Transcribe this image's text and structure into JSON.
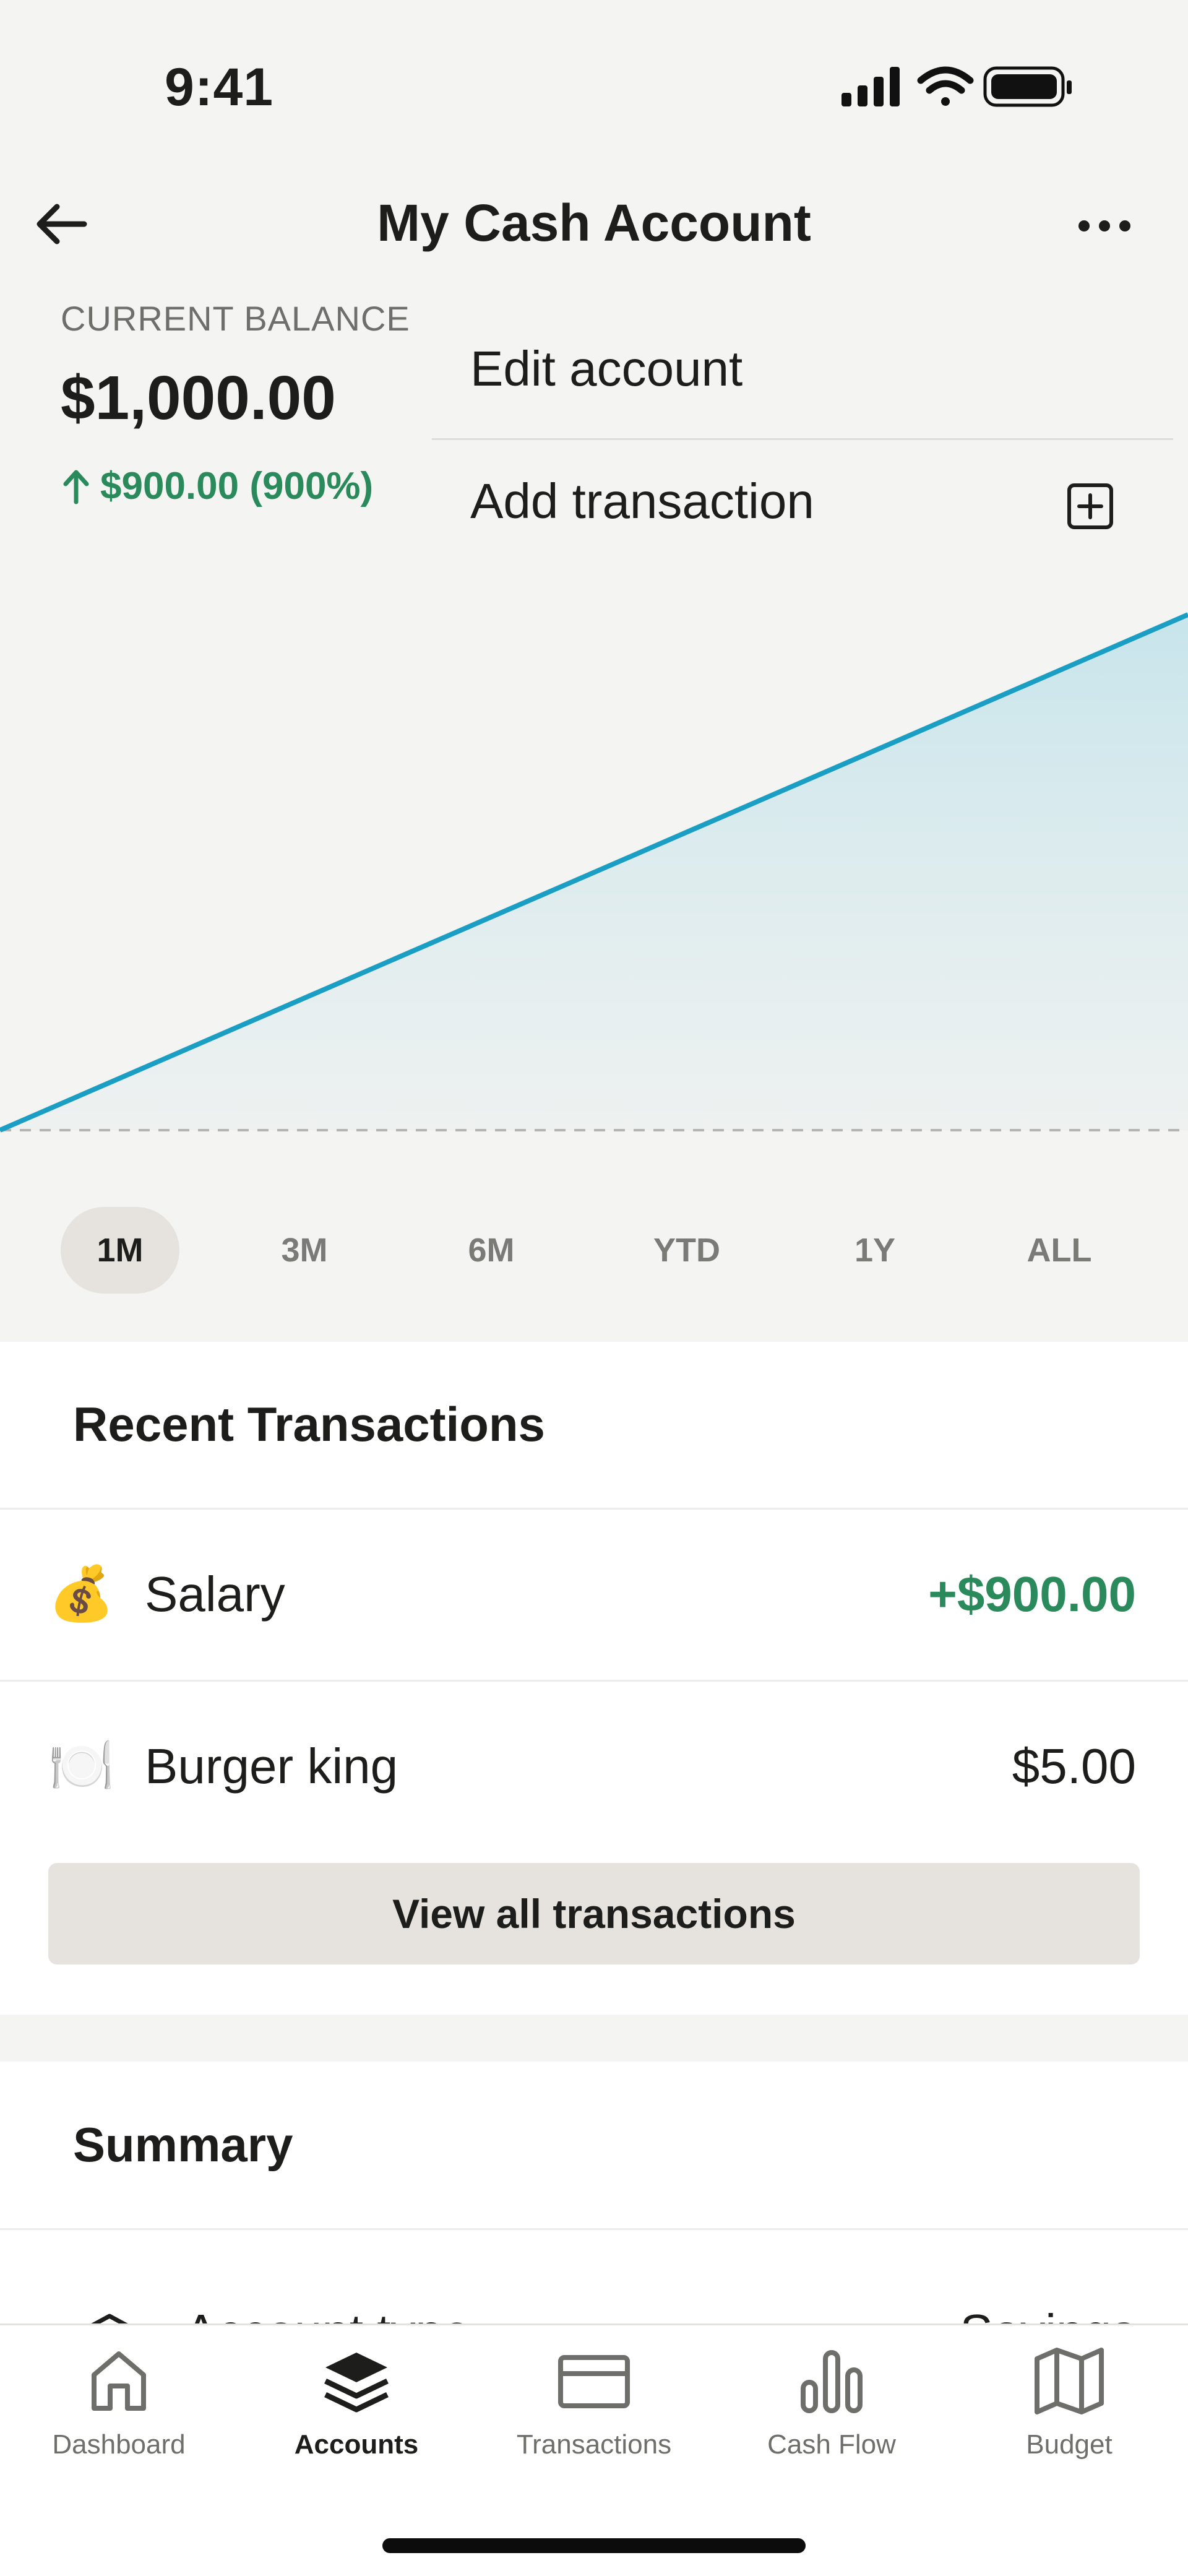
{
  "status_bar": {
    "time": "9:41"
  },
  "header": {
    "title": "My Cash Account"
  },
  "balance": {
    "label": "CURRENT BALANCE",
    "value": "$1,000.00",
    "change": "$900.00 (900%)"
  },
  "menu": {
    "items": [
      {
        "label": "Edit account"
      },
      {
        "label": "Add transaction",
        "icon": "plus-square-icon"
      }
    ]
  },
  "chart_data": {
    "type": "area",
    "x": [
      "start",
      "end"
    ],
    "series": [
      {
        "values": [
          100,
          1000
        ]
      }
    ],
    "baseline": 100,
    "color": "#1a9ec4"
  },
  "time_ranges": {
    "items": [
      "1M",
      "3M",
      "6M",
      "YTD",
      "1Y",
      "ALL"
    ],
    "selected": "1M"
  },
  "recent_transactions": {
    "title": "Recent Transactions",
    "items": [
      {
        "emoji": "💰",
        "name": "Salary",
        "amount": "+$900.00",
        "positive": true
      },
      {
        "emoji": "🍽️",
        "name": "Burger king",
        "amount": "$5.00",
        "positive": false
      }
    ],
    "view_all_label": "View all transactions"
  },
  "summary": {
    "title": "Summary",
    "rows": [
      {
        "icon": "stack-icon",
        "label": "Account type",
        "value": "Savings"
      }
    ]
  },
  "tab_bar": {
    "items": [
      {
        "label": "Dashboard",
        "icon": "home-icon"
      },
      {
        "label": "Accounts",
        "icon": "layers-icon"
      },
      {
        "label": "Transactions",
        "icon": "card-icon"
      },
      {
        "label": "Cash Flow",
        "icon": "bar-chart-icon"
      },
      {
        "label": "Budget",
        "icon": "map-icon"
      }
    ],
    "selected": "Accounts"
  },
  "colors": {
    "accent_positive": "#2a8a5c",
    "chart_line": "#1a9ec4",
    "top_background": "#f4f4f2"
  }
}
